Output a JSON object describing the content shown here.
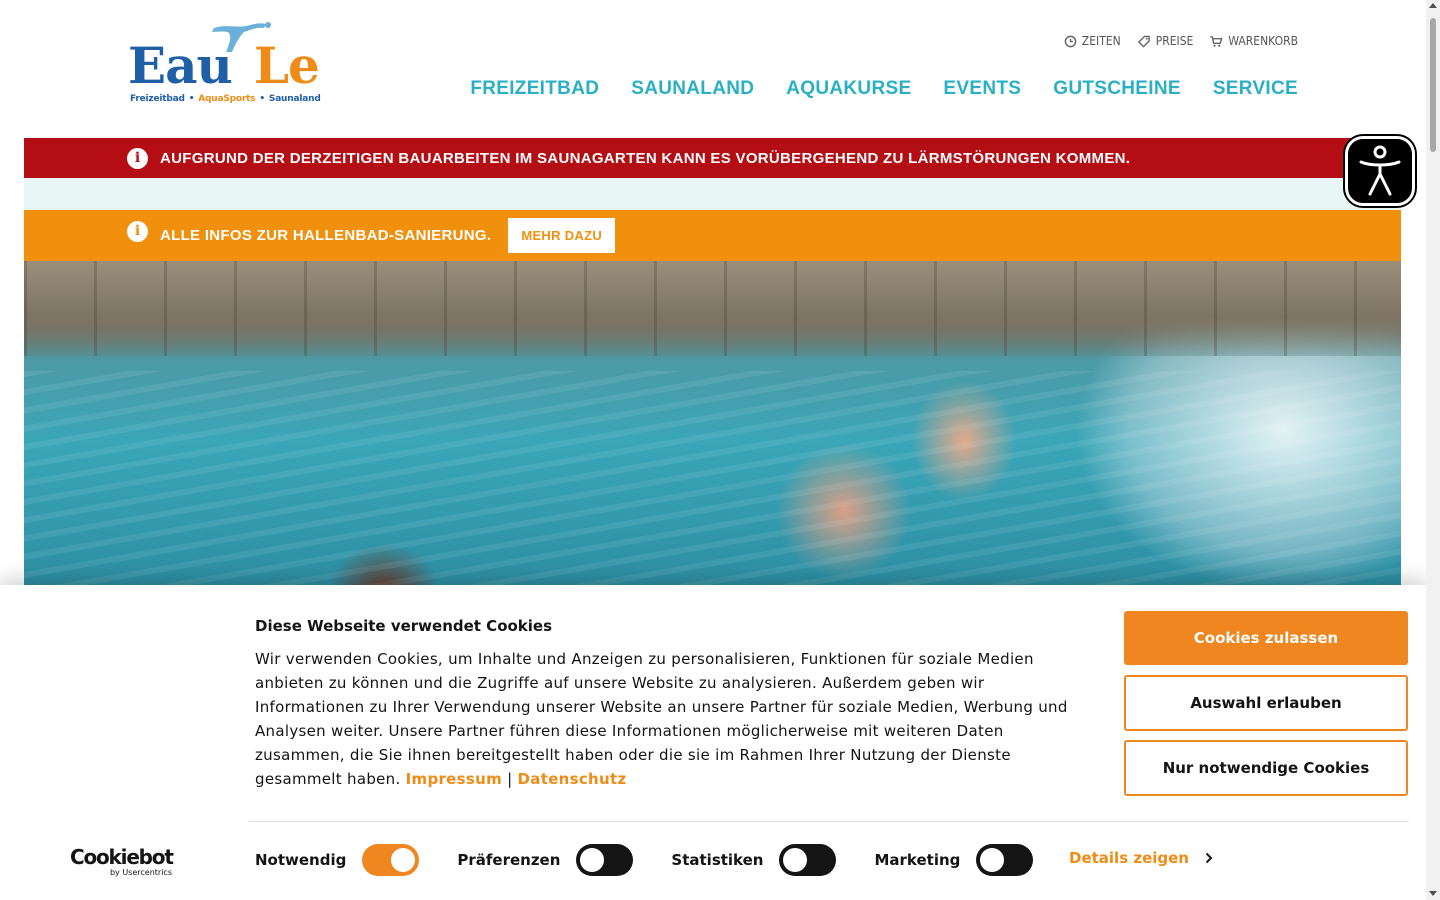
{
  "logo": {
    "name_part1": "Eau",
    "name_part2": "Le",
    "tagline1": "Freizeitbad",
    "tagline2": "AquaSports",
    "tagline3": "Saunaland",
    "colors": {
      "blue": "#1f5fa8",
      "orange": "#ef8c17"
    }
  },
  "topmeta": {
    "items": [
      {
        "label": "ZEITEN",
        "icon": "clock-icon"
      },
      {
        "label": "PREISE",
        "icon": "price-tag-icon"
      },
      {
        "label": "WARENKORB",
        "icon": "cart-icon"
      }
    ]
  },
  "nav": {
    "items": [
      "FREIZEITBAD",
      "SAUNALAND",
      "AQUAKURSE",
      "EVENTS",
      "GUTSCHEINE",
      "SERVICE"
    ],
    "color": "#2ab0c4"
  },
  "alerts": {
    "red": {
      "text": "AUFGRUND DER DERZEITIGEN BAUARBEITEN IM SAUNAGARTEN KANN ES VORÜBERGEHEND ZU LÄRMSTÖRUNGEN KOMMEN.",
      "color": "#b50d14"
    },
    "orange": {
      "text": "ALLE INFOS ZUR HALLENBAD-SANIERUNG.",
      "button": "MEHR DAZU",
      "color": "#f0900d"
    },
    "info_glyph": "i"
  },
  "cookie": {
    "title": "Diese Webseite verwendet Cookies",
    "body": "Wir verwenden Cookies, um Inhalte und Anzeigen zu personalisieren, Funktionen für soziale Medien anbieten zu können und die Zugriffe auf unsere Website zu analysieren. Außerdem geben wir Informationen zu Ihrer Verwendung unserer Website an unsere Partner für soziale Medien, Werbung und Analysen weiter. Unsere Partner führen diese Informationen möglicherweise mit weiteren Daten zusammen, die Sie ihnen bereitgestellt haben oder die sie im Rahmen Ihrer Nutzung der Dienste gesammelt haben.",
    "link_impressum": "Impressum",
    "separator": "|",
    "link_datenschutz": "Datenschutz",
    "btn_allow_all": "Cookies zulassen",
    "btn_allow_selection": "Auswahl erlauben",
    "btn_necessary_only": "Nur notwendige Cookies",
    "toggles": [
      {
        "label": "Notwendig",
        "on": true
      },
      {
        "label": "Präferenzen",
        "on": false
      },
      {
        "label": "Statistiken",
        "on": false
      },
      {
        "label": "Marketing",
        "on": false
      }
    ],
    "details_label": "Details zeigen",
    "accent": "#f0861f",
    "brand": {
      "name": "Cookiebot",
      "sub": "by Usercentrics"
    }
  }
}
